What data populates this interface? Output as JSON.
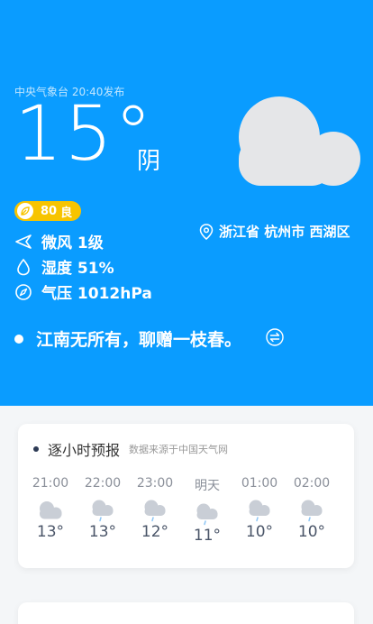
{
  "hero": {
    "publish": "中央气象台 20:40发布",
    "temperature": "15°",
    "condition": "阴",
    "condition_icon": "cloud-icon",
    "aqi": {
      "value": "80",
      "level": "良",
      "color": "#f7c400"
    },
    "location": "浙江省 杭州市 西湖区",
    "wind": "微风 1级",
    "humidity": "湿度 51%",
    "pressure": "气压 1012hPa",
    "quote": "江南无所有，聊赠一枝春。"
  },
  "hourly": {
    "title": "逐小时预报",
    "source": "数据来源于中国天气网",
    "items": [
      {
        "time": "21:00",
        "icon": "cloud-icon",
        "temp": "13°"
      },
      {
        "time": "22:00",
        "icon": "cloud-rain-icon",
        "temp": "13°"
      },
      {
        "time": "23:00",
        "icon": "cloud-rain-icon",
        "temp": "12°"
      },
      {
        "time": "明天",
        "icon": "cloud-rain-icon",
        "temp": "11°"
      },
      {
        "time": "01:00",
        "icon": "cloud-rain-icon",
        "temp": "10°"
      },
      {
        "time": "02:00",
        "icon": "cloud-rain-icon",
        "temp": "10°"
      }
    ]
  },
  "colors": {
    "hero_bg": "#0a9cff",
    "cloud": "#e5e6e8",
    "small_cloud": "#c9ced6",
    "rain": "#8ec6f5"
  }
}
